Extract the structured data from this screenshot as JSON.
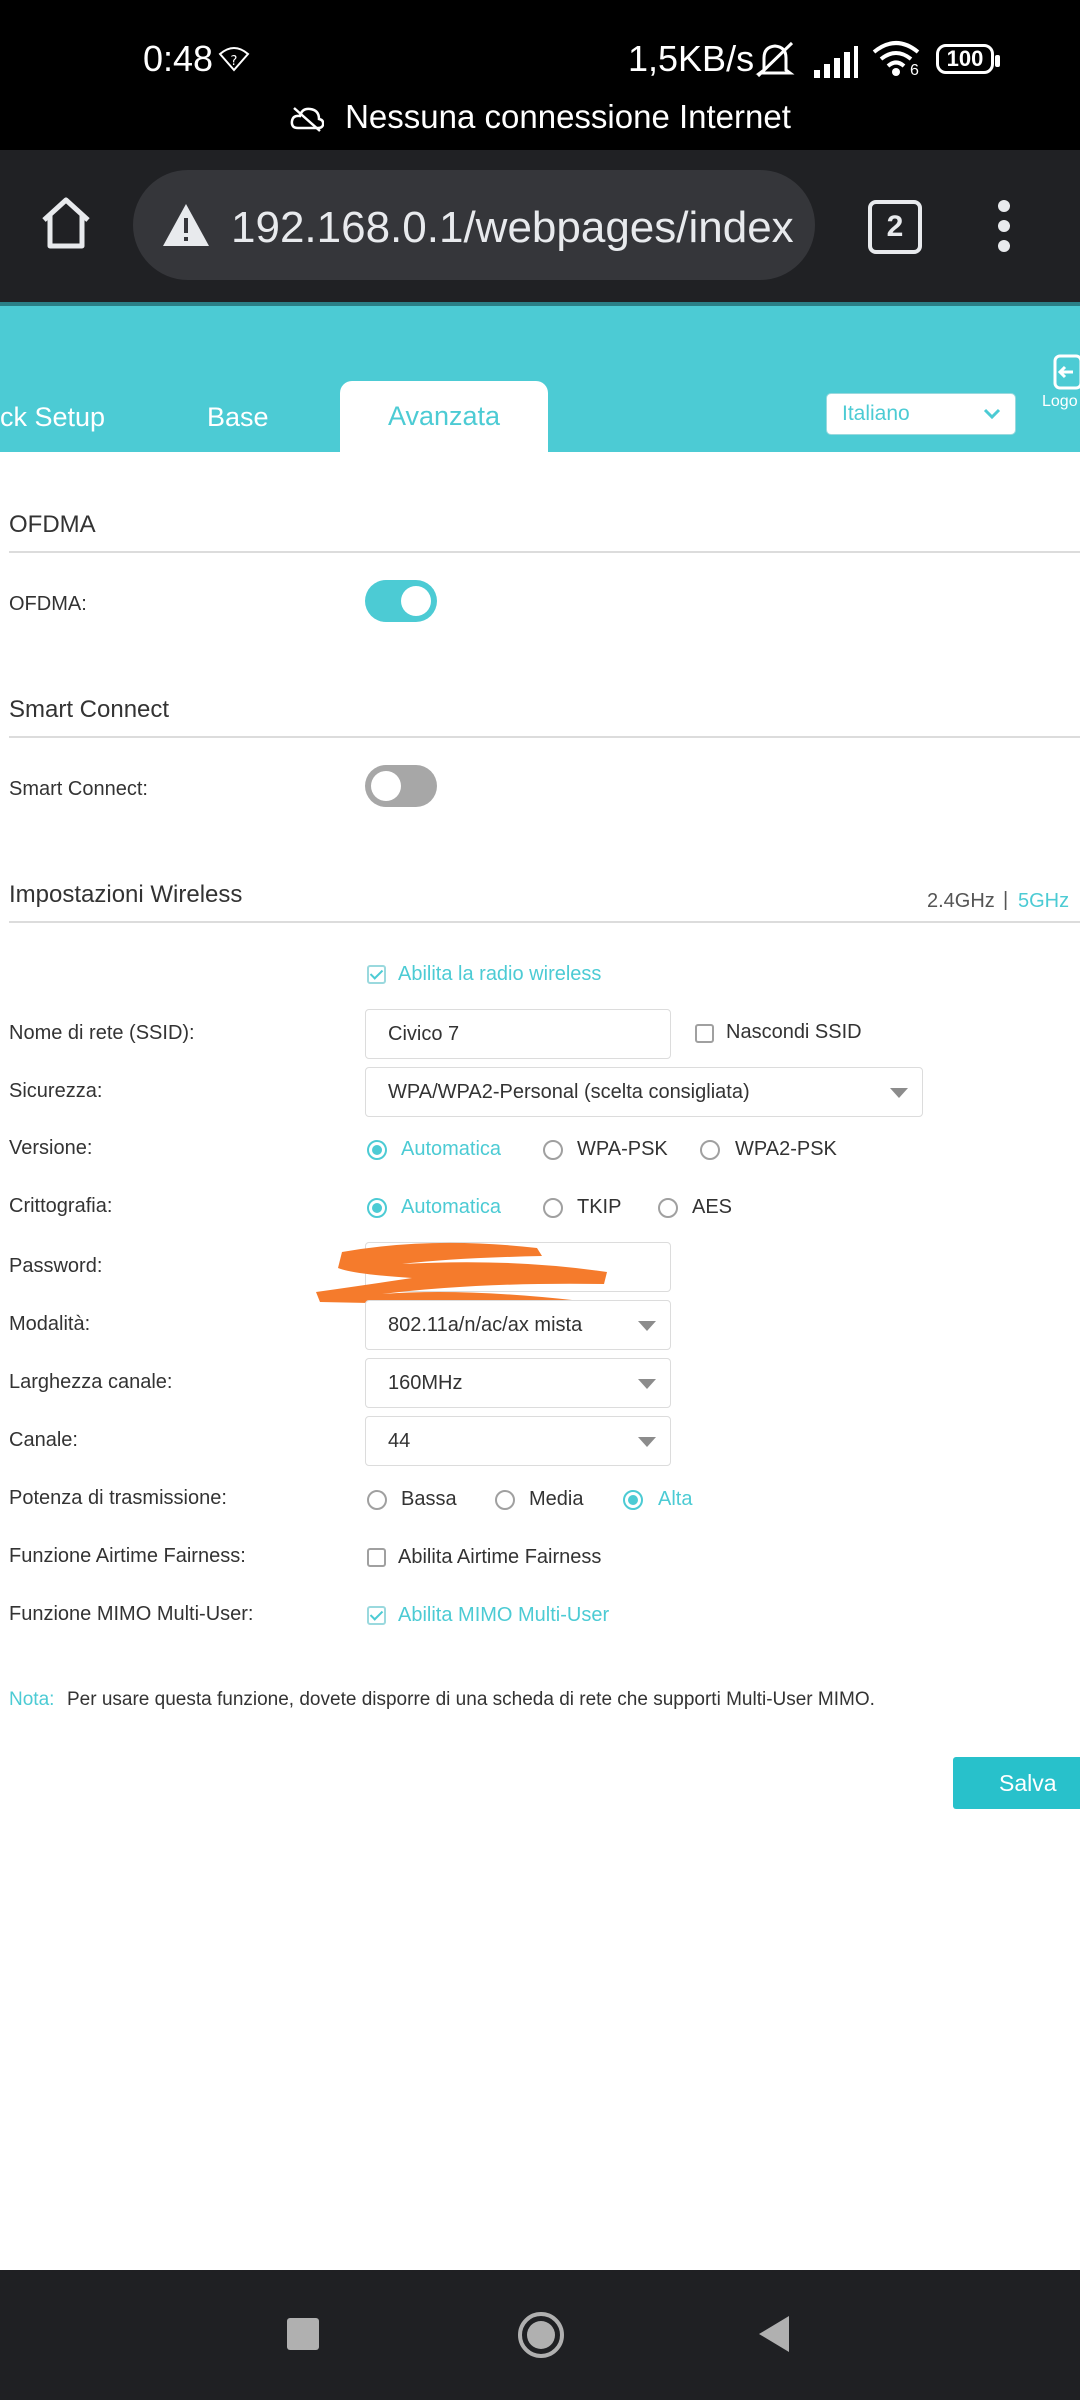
{
  "status_bar": {
    "time": "0:48",
    "speed": "1,5KB/s",
    "battery": "100",
    "wifi_badge": "6",
    "network_message": "Nessuna connessione Internet"
  },
  "browser": {
    "url": "192.168.0.1/webpages/index",
    "tab_count": "2"
  },
  "router_header": {
    "tabs": [
      "ck Setup",
      "Base",
      "Avanzata"
    ],
    "language": "Italiano",
    "logout": "Logo"
  },
  "ofdma": {
    "section_title": "OFDMA",
    "label": "OFDMA:",
    "enabled": true
  },
  "smart_connect": {
    "section_title": "Smart Connect",
    "label": "Smart Connect:",
    "enabled": false
  },
  "wireless": {
    "section_title": "Impostazioni Wireless",
    "band_24": "2.4GHz",
    "band_sep": "|",
    "band_5": "5GHz",
    "enable_radio": "Abilita la radio wireless",
    "ssid_label": "Nome di rete (SSID):",
    "ssid_value": "Civico 7",
    "hide_ssid": "Nascondi SSID",
    "security_label": "Sicurezza:",
    "security_value": "WPA/WPA2-Personal (scelta consigliata)",
    "version_label": "Versione:",
    "version_options": [
      "Automatica",
      "WPA-PSK",
      "WPA2-PSK"
    ],
    "encryption_label": "Crittografia:",
    "encryption_options": [
      "Automatica",
      "TKIP",
      "AES"
    ],
    "password_label": "Password:",
    "mode_label": "Modalità:",
    "mode_value": "802.11a/n/ac/ax mista",
    "channel_width_label": "Larghezza canale:",
    "channel_width_value": "160MHz",
    "channel_label": "Canale:",
    "channel_value": "44",
    "tx_power_label": "Potenza di trasmissione:",
    "tx_power_options": [
      "Bassa",
      "Media",
      "Alta"
    ],
    "airtime_label": "Funzione Airtime Fairness:",
    "airtime_option": "Abilita Airtime Fairness",
    "mimo_label": "Funzione MIMO Multi-User:",
    "mimo_option": "Abilita MIMO Multi-User",
    "note_prefix": "Nota:",
    "note_text": "Per usare questa funzione, dovete disporre di una scheda di rete che supporti Multi-User MIMO.",
    "save_button": "Salva"
  },
  "colors": {
    "accent": "#4ccbd4",
    "status_bar": "#000000",
    "browser_bar": "#202124",
    "redaction": "#f57b2c"
  }
}
